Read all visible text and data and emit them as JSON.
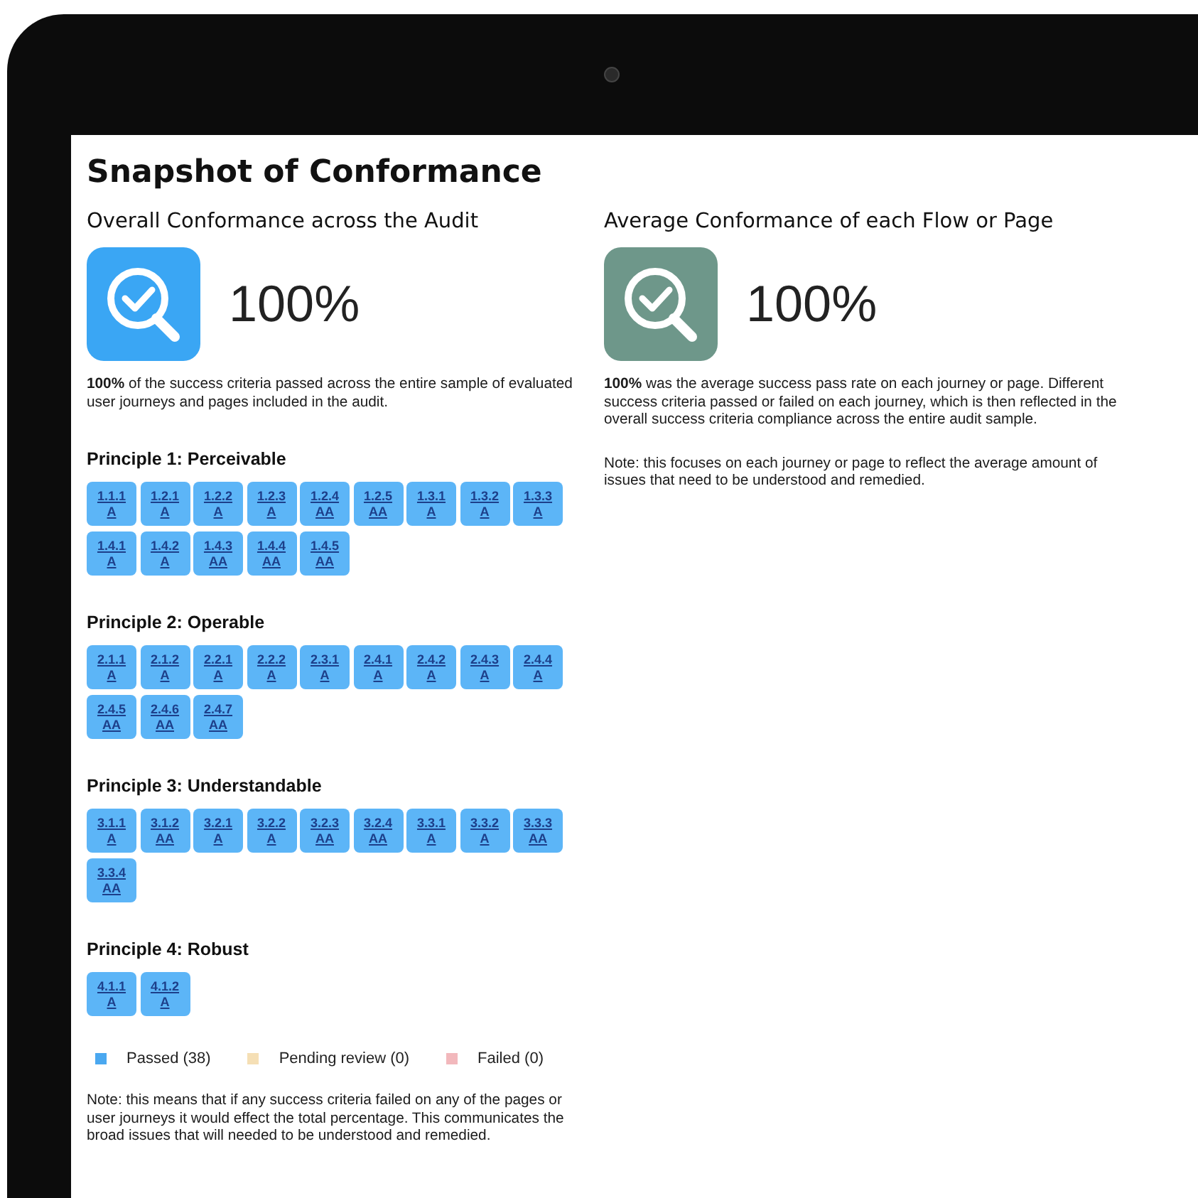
{
  "title": "Snapshot of Conformance",
  "summaries": [
    {
      "heading": "Overall Conformance across the Audit",
      "percent": "100%",
      "kind": "overall",
      "text": "**100%** of the success criteria passed across the entire sample of evaluated user journeys and pages included in the audit."
    },
    {
      "heading": "Average Conformance of each Flow or Page",
      "percent": "100%",
      "kind": "average",
      "text": "**100%** was the average success pass rate on each journey or page. Different success criteria passed or failed on each journey, which is then reflected in the overall success criteria compliance across the entire audit sample.",
      "note": "Note: this focuses on each journey or page to reflect the average amount of issues that need to be understood and remedied."
    }
  ],
  "principles": [
    {
      "heading": "Principle 1: Perceivable",
      "criteria": [
        {
          "code": "1.1.1",
          "level": "A",
          "passed": true
        },
        {
          "code": "1.2.1",
          "level": "A",
          "passed": true
        },
        {
          "code": "1.2.2",
          "level": "A",
          "passed": true
        },
        {
          "code": "1.2.3",
          "level": "A",
          "passed": true
        },
        {
          "code": "1.2.4",
          "level": "AA",
          "passed": true
        },
        {
          "code": "1.2.5",
          "level": "AA",
          "passed": true
        },
        {
          "code": "1.3.1",
          "level": "A",
          "passed": true
        },
        {
          "code": "1.3.2",
          "level": "A",
          "passed": true
        },
        {
          "code": "1.3.3",
          "level": "A",
          "passed": true
        },
        {
          "code": "1.4.1",
          "level": "A",
          "passed": true
        },
        {
          "code": "1.4.2",
          "level": "A",
          "passed": true
        },
        {
          "code": "1.4.3",
          "level": "AA",
          "passed": true
        },
        {
          "code": "1.4.4",
          "level": "AA",
          "passed": true
        },
        {
          "code": "1.4.5",
          "level": "AA",
          "passed": true
        }
      ]
    },
    {
      "heading": "Principle 2: Operable",
      "criteria": [
        {
          "code": "2.1.1",
          "level": "A",
          "passed": true
        },
        {
          "code": "2.1.2",
          "level": "A",
          "passed": true
        },
        {
          "code": "2.2.1",
          "level": "A",
          "passed": true
        },
        {
          "code": "2.2.2",
          "level": "A",
          "passed": true
        },
        {
          "code": "2.3.1",
          "level": "A",
          "passed": true
        },
        {
          "code": "2.4.1",
          "level": "A",
          "passed": true
        },
        {
          "code": "2.4.2",
          "level": "A",
          "passed": true
        },
        {
          "code": "2.4.3",
          "level": "A",
          "passed": true
        },
        {
          "code": "2.4.4",
          "level": "A",
          "passed": true
        },
        {
          "code": "2.4.5",
          "level": "AA",
          "passed": true
        },
        {
          "code": "2.4.6",
          "level": "AA",
          "passed": true
        },
        {
          "code": "2.4.7",
          "level": "AA",
          "passed": true
        }
      ]
    },
    {
      "heading": "Principle 3: Understandable",
      "criteria": [
        {
          "code": "3.1.1",
          "level": "A",
          "passed": true
        },
        {
          "code": "3.1.2",
          "level": "AA",
          "passed": true
        },
        {
          "code": "3.2.1",
          "level": "A",
          "passed": true
        },
        {
          "code": "3.2.2",
          "level": "A",
          "passed": true
        },
        {
          "code": "3.2.3",
          "level": "AA",
          "passed": true
        },
        {
          "code": "3.2.4",
          "level": "AA",
          "passed": true
        },
        {
          "code": "3.3.1",
          "level": "A",
          "passed": true
        },
        {
          "code": "3.3.2",
          "level": "A",
          "passed": true
        },
        {
          "code": "3.3.3",
          "level": "AA",
          "passed": true
        },
        {
          "code": "3.3.4",
          "level": "AA",
          "passed": true
        }
      ]
    },
    {
      "heading": "Principle 4: Robust",
      "criteria": [
        {
          "code": "4.1.1",
          "level": "A",
          "passed": true
        },
        {
          "code": "4.1.2",
          "level": "A",
          "passed": true
        }
      ]
    }
  ],
  "legend": [
    {
      "label": "Passed (38)",
      "color": "#4aa8f0"
    },
    {
      "label": "Pending review (0)",
      "color": "#f5dfb5"
    },
    {
      "label": "Failed (0)",
      "color": "#f2b8bc"
    }
  ],
  "note": "Note: this means that if any success criteria failed on any of the pages or user journeys it would effect the total percentage. This communicates the broad issues that will needed to be understood and remedied."
}
